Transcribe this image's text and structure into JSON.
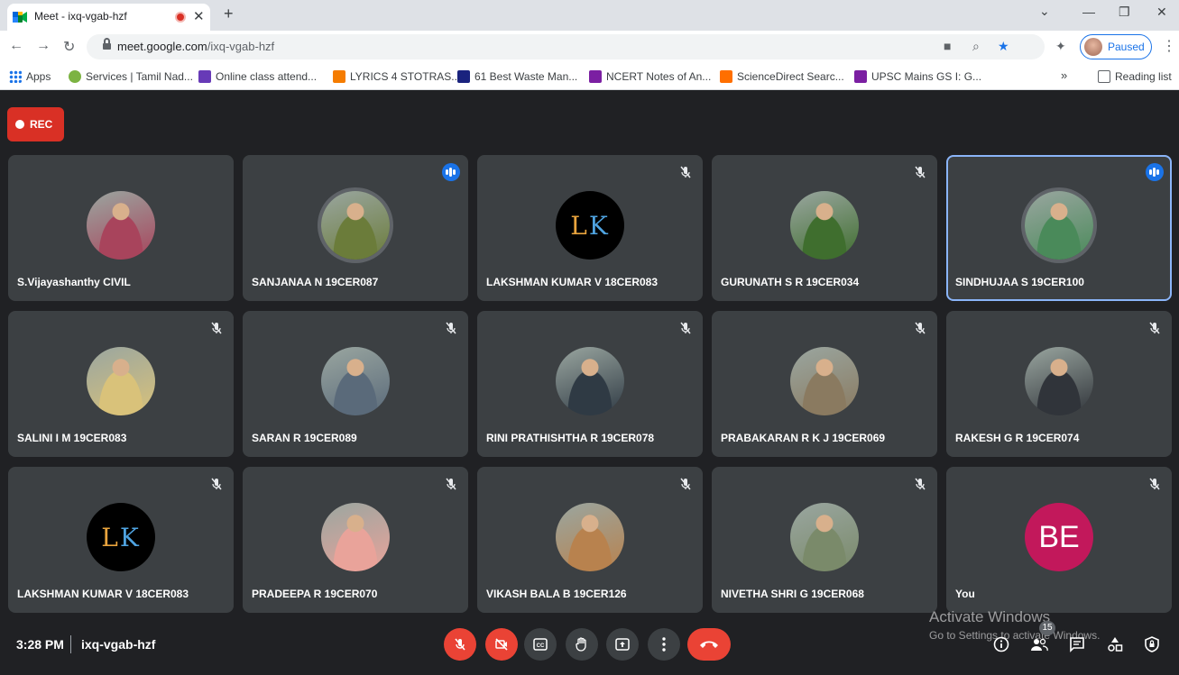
{
  "browser": {
    "tab_title": "Meet - ixq-vgab-hzf",
    "url_host": "meet.google.com",
    "url_path": "/ixq-vgab-hzf",
    "profile_label": "Paused",
    "window_controls": {
      "minimize": "—",
      "restore": "❐",
      "close": "✕"
    },
    "new_tab": "+",
    "tab_close": "✕"
  },
  "bookmarks": [
    {
      "label": "Apps",
      "icon": "apps-icon",
      "color": "#1a73e8"
    },
    {
      "label": "Services | Tamil Nad...",
      "icon": "tn-emblem-icon",
      "color": "#7cb342"
    },
    {
      "label": "Online class attend...",
      "icon": "forms-icon",
      "color": "#673ab7"
    },
    {
      "label": "LYRICS 4 STOTRAS...",
      "icon": "blogger-icon",
      "color": "#f57c00"
    },
    {
      "label": "61 Best Waste Man...",
      "icon": "doc-icon",
      "color": "#1a237e"
    },
    {
      "label": "NCERT Notes of An...",
      "icon": "bookmark-b-icon",
      "color": "#7b1fa2"
    },
    {
      "label": "ScienceDirect Searc...",
      "icon": "elsevier-icon",
      "color": "#ff6f00"
    },
    {
      "label": "UPSC Mains GS I: G...",
      "icon": "bookmark-b-icon",
      "color": "#7b1fa2"
    }
  ],
  "bookmarks_more": "»",
  "reading_list": "Reading list",
  "meeting": {
    "rec_label": "REC",
    "time": "3:28 PM",
    "code": "ixq-vgab-hzf",
    "participant_count": "15"
  },
  "participants": [
    {
      "name": "S.Vijayashanthy CIVIL",
      "status": "none",
      "avatar": "photo",
      "bg": "#a8445c"
    },
    {
      "name": "SANJANAA N 19CER087",
      "status": "speaking",
      "avatar": "photo",
      "bg": "#6b7c3a"
    },
    {
      "name": "LAKSHMAN KUMAR V 18CER083",
      "status": "muted",
      "avatar": "letters",
      "initials_1": "L",
      "initials_2": "K"
    },
    {
      "name": "GURUNATH S R 19CER034",
      "status": "muted",
      "avatar": "photo",
      "bg": "#3f6e2e"
    },
    {
      "name": "SINDHUJAA S 19CER100",
      "status": "speaking",
      "avatar": "photo",
      "bg": "#4a8a5a",
      "highlight": true
    },
    {
      "name": "SALINI I M 19CER083",
      "status": "muted",
      "avatar": "photo",
      "bg": "#d9c27a"
    },
    {
      "name": "SARAN R 19CER089",
      "status": "muted",
      "avatar": "photo",
      "bg": "#5a6a7a"
    },
    {
      "name": "RINI PRATHISHTHA R 19CER078",
      "status": "muted",
      "avatar": "photo",
      "bg": "#2f3a44"
    },
    {
      "name": "PRABAKARAN R K J 19CER069",
      "status": "muted",
      "avatar": "photo",
      "bg": "#8a7a60"
    },
    {
      "name": "RAKESH G R 19CER074",
      "status": "muted",
      "avatar": "photo",
      "bg": "#30343a"
    },
    {
      "name": "LAKSHMAN KUMAR V 18CER083",
      "status": "muted",
      "avatar": "letters",
      "initials_1": "L",
      "initials_2": "K"
    },
    {
      "name": "PRADEEPA R 19CER070",
      "status": "muted",
      "avatar": "photo",
      "bg": "#e9a39a"
    },
    {
      "name": "VIKASH BALA B 19CER126",
      "status": "muted",
      "avatar": "photo",
      "bg": "#b8824e"
    },
    {
      "name": "NIVETHA SHRI G 19CER068",
      "status": "muted",
      "avatar": "photo",
      "bg": "#7a8a6a"
    },
    {
      "name": "You",
      "status": "muted",
      "avatar": "you",
      "initials": "BE"
    }
  ],
  "controls": [
    {
      "name": "mic-off-button",
      "icon": "mic-off-icon",
      "glyph": "🎤",
      "style": "red"
    },
    {
      "name": "camera-off-button",
      "icon": "camera-off-icon",
      "glyph": "⊘",
      "style": "red"
    },
    {
      "name": "captions-button",
      "icon": "captions-icon",
      "glyph": "CC",
      "style": "grey"
    },
    {
      "name": "raise-hand-button",
      "icon": "hand-icon",
      "glyph": "✋",
      "style": "grey"
    },
    {
      "name": "present-button",
      "icon": "present-icon",
      "glyph": "⬆",
      "style": "grey"
    },
    {
      "name": "more-options-button",
      "icon": "more-vert-icon",
      "glyph": "⋮",
      "style": "grey"
    },
    {
      "name": "leave-call-button",
      "icon": "call-end-icon",
      "glyph": "☎",
      "style": "hangup"
    }
  ],
  "watermark": {
    "line1": "Activate Windows",
    "line2": "Go to Settings to activate Windows."
  },
  "colors": {
    "meet_bg": "#202124",
    "tile_bg": "#3c4043",
    "rec_red": "#d93025",
    "accent_blue": "#1a73e8",
    "hangup_red": "#ea4335"
  }
}
